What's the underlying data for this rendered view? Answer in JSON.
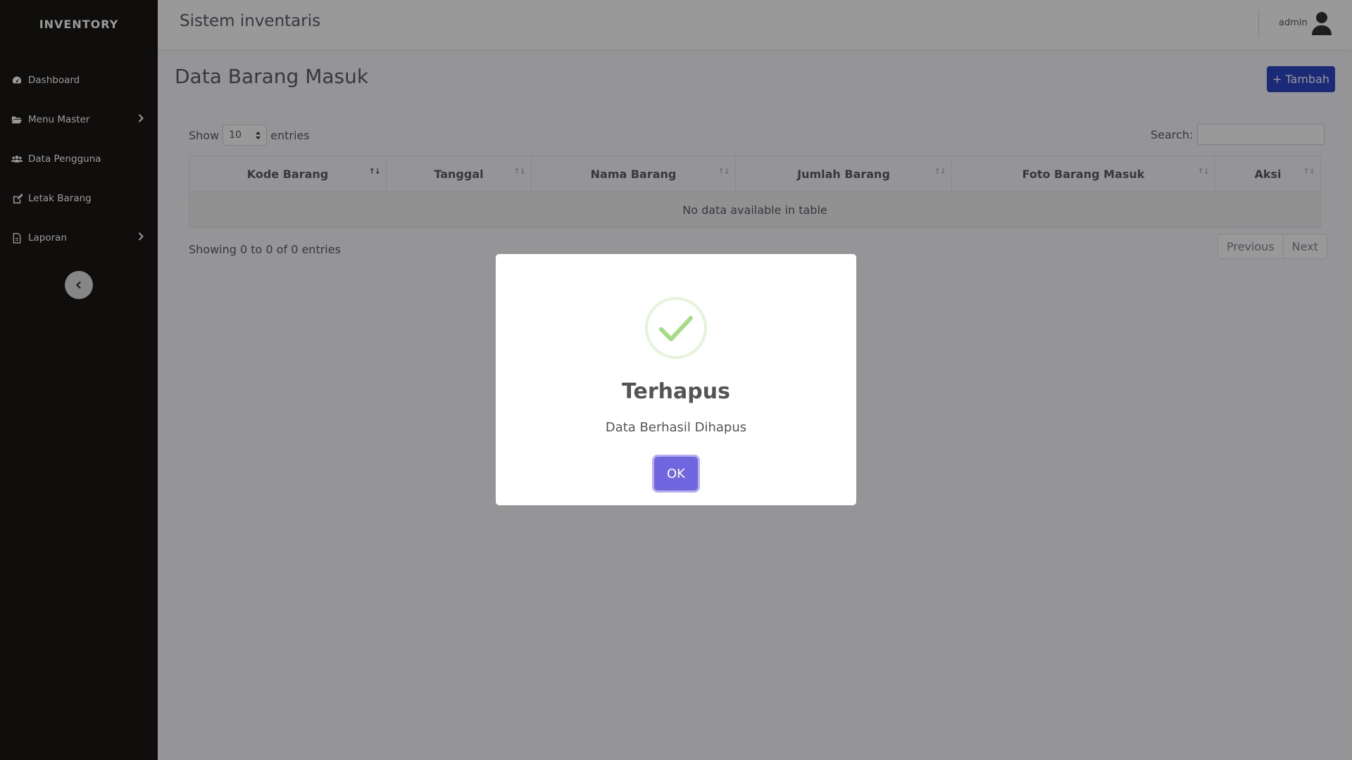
{
  "sidebar": {
    "brand": "INVENTORY",
    "items": [
      {
        "label": "Dashboard",
        "icon": "dashboard-icon"
      },
      {
        "label": "Menu Master",
        "icon": "folder-open-icon",
        "has_submenu": true
      },
      {
        "label": "Data Pengguna",
        "icon": "users-icon"
      },
      {
        "label": "Letak Barang",
        "icon": "edit-icon"
      },
      {
        "label": "Laporan",
        "icon": "file-pdf-icon",
        "has_submenu": true
      }
    ]
  },
  "topbar": {
    "title": "Sistem inventaris",
    "user": "admin"
  },
  "page": {
    "title": "Data Barang Masuk",
    "add_button": "+ Tambah"
  },
  "table_controls": {
    "show_label": "Show",
    "page_size": "10",
    "entries_label": "entries",
    "search_label": "Search:",
    "search_value": ""
  },
  "table": {
    "columns": [
      "Kode Barang",
      "Tanggal",
      "Nama Barang",
      "Jumlah Barang",
      "Foto Barang Masuk",
      "Aksi"
    ],
    "empty_message": "No data available in table"
  },
  "footer": {
    "info": "Showing 0 to 0 of 0 entries",
    "previous": "Previous",
    "next": "Next"
  },
  "dialog": {
    "title": "Terhapus",
    "message": "Data Berhasil Dihapus",
    "ok": "OK"
  },
  "colors": {
    "sidebar_bg": "#1b1616",
    "primary_button": "#2e47c7",
    "dialog_confirm": "#7066e0",
    "success": "#a5dc86"
  }
}
